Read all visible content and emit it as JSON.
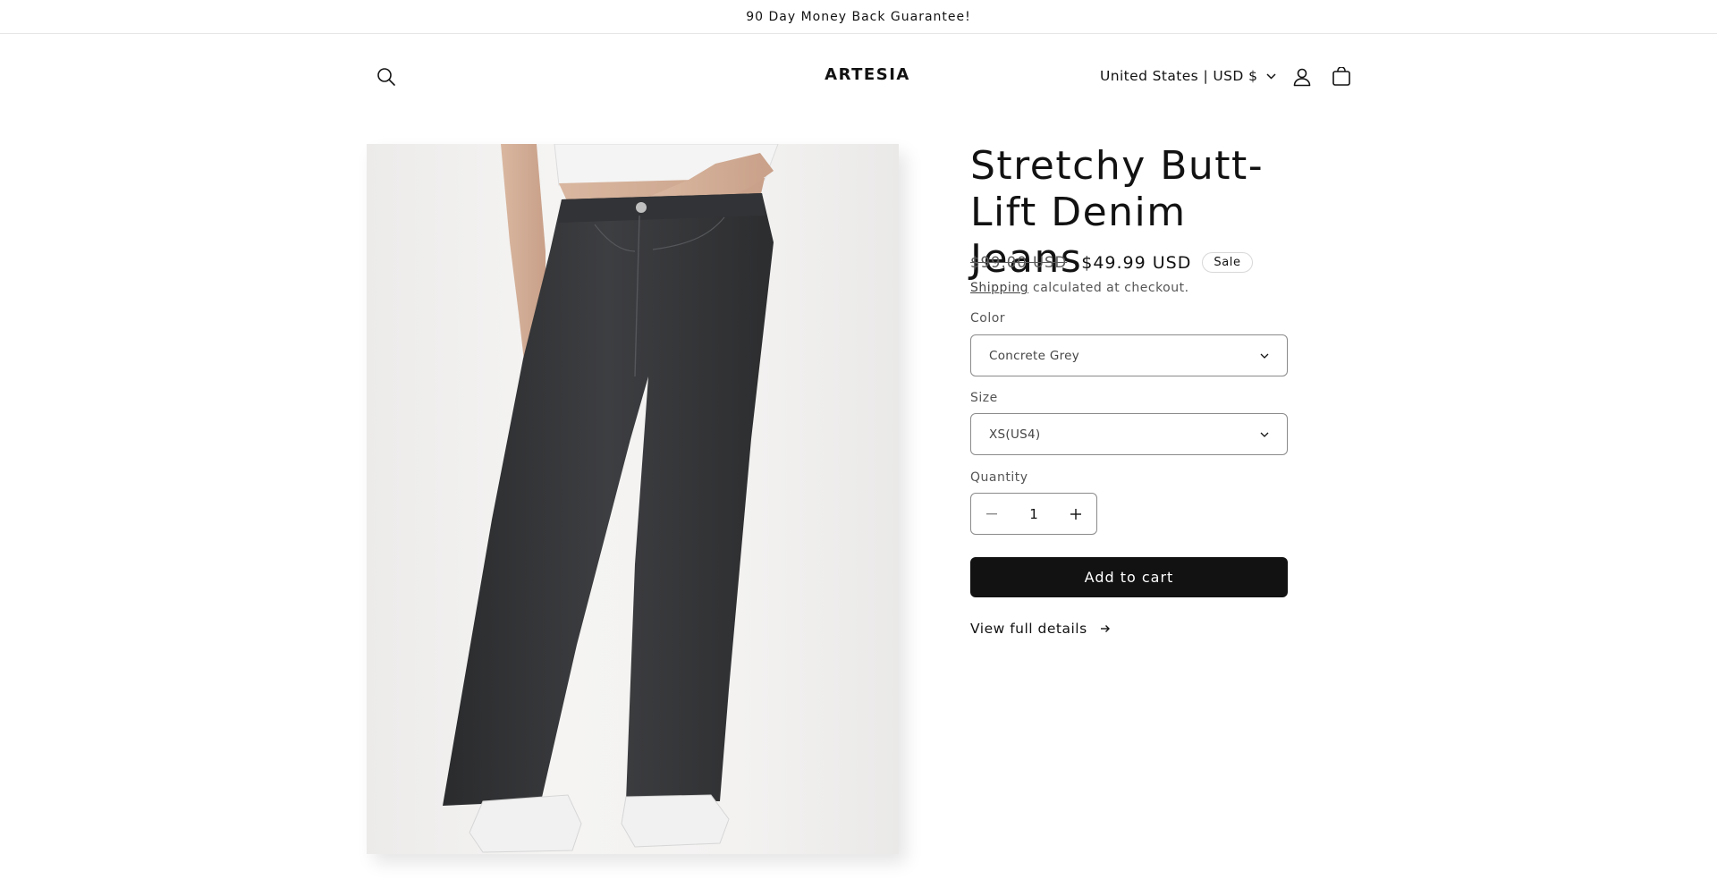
{
  "announcement": {
    "text": "90 Day Money Back Guarantee!"
  },
  "header": {
    "logo_text": "ARTESIA",
    "country_currency": "United States | USD $",
    "icons": {
      "search": "search-icon",
      "account": "account-icon",
      "cart": "cart-icon"
    }
  },
  "product": {
    "title": "Stretchy Butt-Lift Denim Jeans",
    "regular_price": "$99.00 USD",
    "sale_price": "$49.99 USD",
    "sale_badge": "Sale",
    "shipping_link": "Shipping",
    "shipping_text": " calculated at checkout.",
    "image_alt": "Grey wide-leg denim jeans on model"
  },
  "options": {
    "color_label": "Color",
    "color_value": "Concrete Grey",
    "size_label": "Size",
    "size_value": "XS(US4)",
    "quantity_label": "Quantity",
    "quantity_value": "1"
  },
  "actions": {
    "add_to_cart": "Add to cart",
    "view_full_details": "View full details"
  },
  "colors": {
    "text": "#121212",
    "button_bg": "#121212",
    "button_text": "#ffffff",
    "border": "#8a8a8a"
  }
}
